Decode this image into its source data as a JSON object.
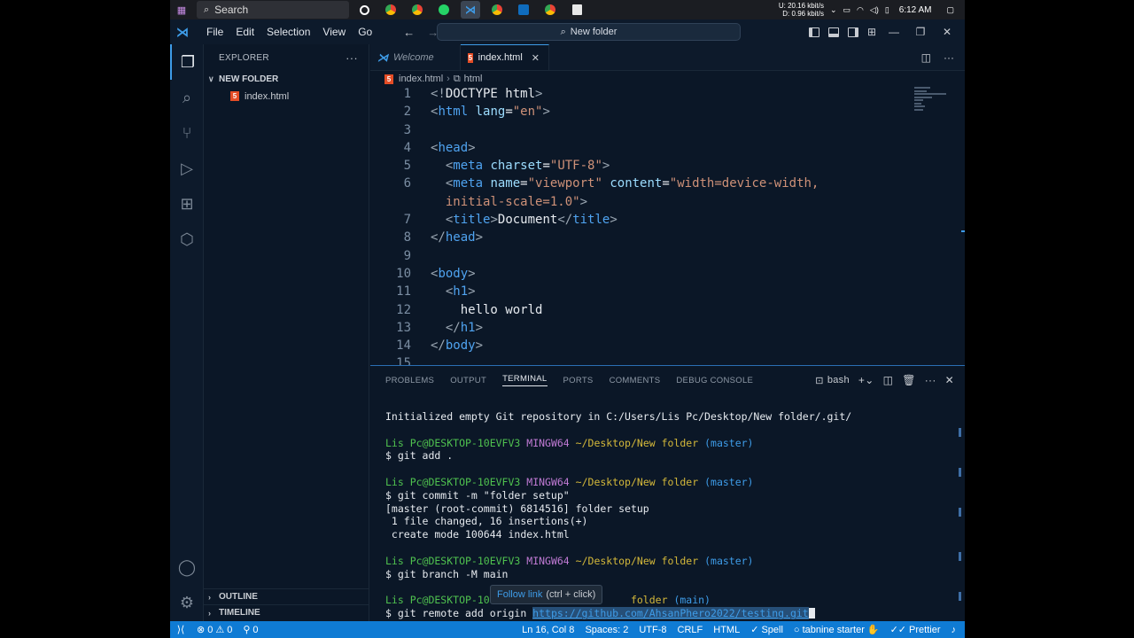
{
  "taskbar": {
    "search_placeholder": "Search",
    "net_up": "20.16 kbit/s",
    "net_down": "0.96 kbit/s",
    "net_up_label": "U:",
    "net_down_label": "D:",
    "time": "6:12 AM"
  },
  "titlebar": {
    "menu": [
      "File",
      "Edit",
      "Selection",
      "View",
      "Go"
    ],
    "command_center": "New folder"
  },
  "sidebar": {
    "header": "EXPLORER",
    "folder": "NEW FOLDER",
    "file": "index.html",
    "outline": "OUTLINE",
    "timeline": "TIMELINE"
  },
  "editor": {
    "tabs": [
      {
        "label": "Welcome"
      },
      {
        "label": "index.html"
      }
    ],
    "breadcrumb": [
      "index.html",
      "html"
    ],
    "line_numbers": [
      "1",
      "2",
      "3",
      "4",
      "5",
      "6",
      "7",
      "8",
      "9",
      "10",
      "11",
      "12",
      "13",
      "14",
      "15"
    ],
    "code": {
      "l1": [
        "<!",
        "DOCTYPE",
        " html",
        ">"
      ],
      "l2": [
        "<",
        "html",
        " lang",
        "=",
        "\"en\"",
        ">"
      ],
      "l4": [
        "<",
        "head",
        ">"
      ],
      "l5": [
        "<",
        "meta",
        " charset",
        "=",
        "\"UTF-8\"",
        ">"
      ],
      "l6a": [
        "<",
        "meta",
        " name",
        "=",
        "\"viewport\"",
        " content",
        "=",
        "\"width=device-width,"
      ],
      "l6b": [
        "initial-scale=1.0\"",
        ">"
      ],
      "l7": [
        "<",
        "title",
        ">",
        "Document",
        "</",
        "title",
        ">"
      ],
      "l8": [
        "</",
        "head",
        ">"
      ],
      "l10": [
        "<",
        "body",
        ">"
      ],
      "l11": [
        "<",
        "h1",
        ">"
      ],
      "l12": "hello world",
      "l13": [
        "</",
        "h1",
        ">"
      ],
      "l14": [
        "</",
        "body",
        ">"
      ]
    }
  },
  "panel": {
    "tabs": [
      "PROBLEMS",
      "OUTPUT",
      "TERMINAL",
      "PORTS",
      "COMMENTS",
      "DEBUG CONSOLE"
    ],
    "active_tab": "TERMINAL",
    "shell": "bash",
    "terminal": {
      "init": "Initialized empty Git repository in C:/Users/Lis Pc/Desktop/New folder/.git/",
      "user": "Lis Pc@DESKTOP-10EVFV3",
      "mingw": "MINGW64",
      "path": "~/Desktop/New folder",
      "branch_master": "(master)",
      "branch_main": "(main)",
      "cmd1": "$ git add .",
      "cmd2": "$ git commit -m \"folder setup\"",
      "out2a": "[master (root-commit) 6814516] folder setup",
      "out2b": " 1 file changed, 16 insertions(+)",
      "out2c": " create mode 100644 index.html",
      "cmd3": "$ git branch -M main",
      "partial_user": "Lis Pc@DESKTOP-10EVFV3 M",
      "partial_path": "folder",
      "cmd4": "$ git remote add origin ",
      "url": "https://github.com/AhsanPhero2022/testing.git"
    },
    "tooltip": {
      "label": "Follow link",
      "hint": "(ctrl + click)"
    }
  },
  "statusbar": {
    "errors": "0",
    "warnings": "0",
    "ports": "0",
    "position": "Ln 16, Col 8",
    "spaces": "Spaces: 2",
    "encoding": "UTF-8",
    "eol": "CRLF",
    "language": "HTML",
    "spell": "Spell",
    "tabnine": "tabnine starter",
    "prettier": "Prettier"
  },
  "colors": {
    "accent": "#3e9ce8",
    "statusbar": "#0f7bd4",
    "background": "#0b1727"
  }
}
